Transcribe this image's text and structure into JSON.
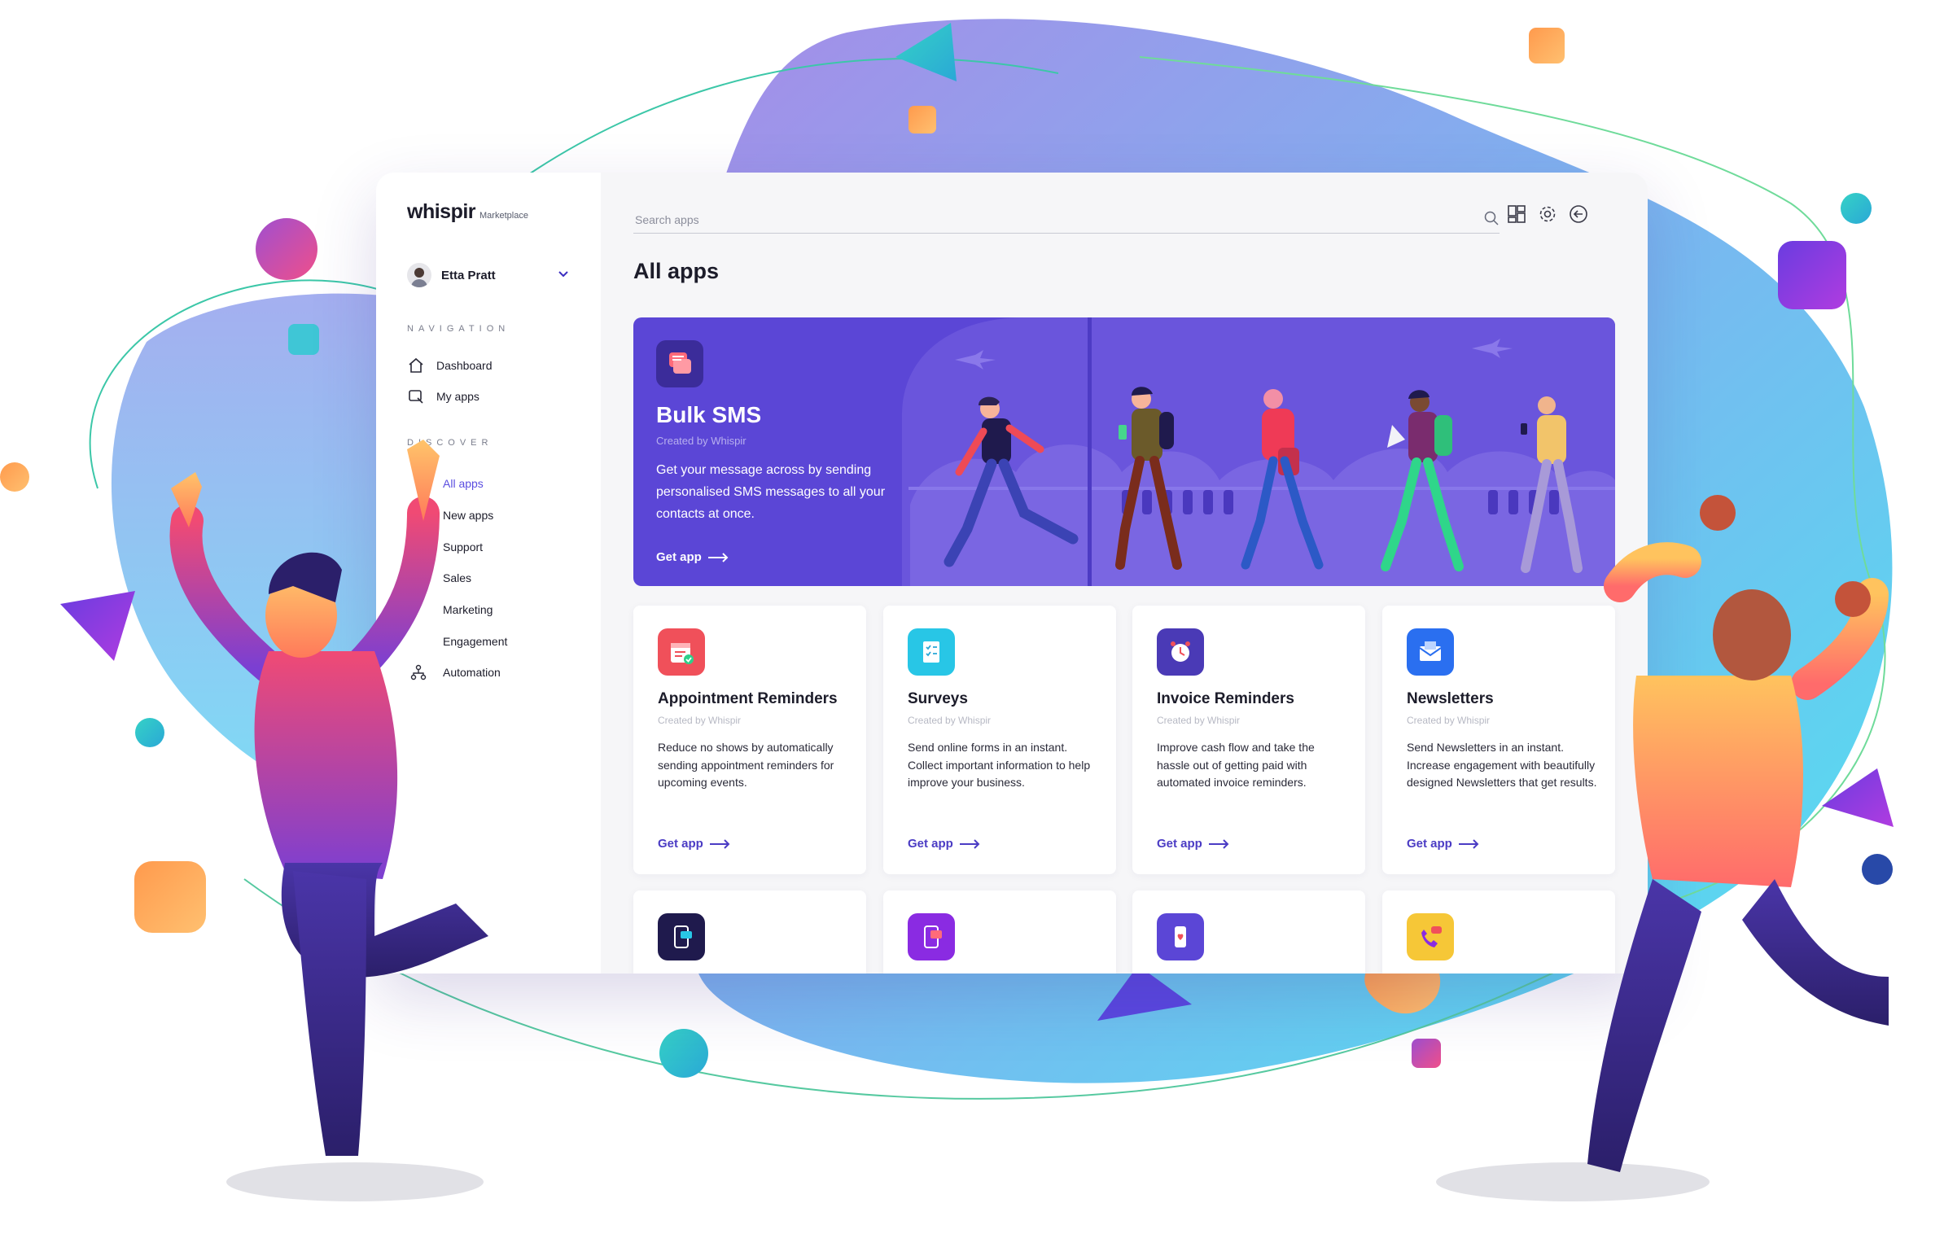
{
  "brand": {
    "logo": "whispir",
    "sub": "Marketplace"
  },
  "user": {
    "name": "Etta Pratt"
  },
  "sidebar": {
    "navigation_heading": "NAVIGATION",
    "nav_items": [
      {
        "label": "Dashboard",
        "icon": "home-icon"
      },
      {
        "label": "My apps",
        "icon": "my-apps-icon"
      }
    ],
    "discover_heading": "DISCOVER",
    "discover_items": [
      {
        "label": "All apps",
        "active": true
      },
      {
        "label": "New apps"
      },
      {
        "label": "Support"
      },
      {
        "label": "Sales"
      },
      {
        "label": "Marketing"
      },
      {
        "label": "Engagement"
      },
      {
        "label": "Automation"
      }
    ]
  },
  "search": {
    "placeholder": "Search apps"
  },
  "page": {
    "title": "All apps"
  },
  "featured": {
    "title": "Bulk SMS",
    "created": "Created by Whispir",
    "description": "Get your message across by sending personalised SMS messages to all your contacts at once.",
    "cta": "Get app"
  },
  "apps": [
    {
      "title": "Appointment Reminders",
      "created": "Created by Whispir",
      "description": "Reduce no shows by automatically sending appointment reminders for upcoming events.",
      "cta": "Get app",
      "icon": "calendar-check-icon",
      "color": "#f0505a"
    },
    {
      "title": "Surveys",
      "created": "Created by Whispir",
      "description": "Send online forms in an instant. Collect important information to help improve your business.",
      "cta": "Get app",
      "icon": "survey-form-icon",
      "color": "#28c6e6"
    },
    {
      "title": "Invoice Reminders",
      "created": "Created by Whispir",
      "description": "Improve cash flow and take the hassle out of getting paid with automated invoice reminders.",
      "cta": "Get app",
      "icon": "alarm-clock-icon",
      "color": "#4a3ab6"
    },
    {
      "title": "Newsletters",
      "created": "Created by Whispir",
      "description": "Send Newsletters in an instant. Increase engagement with beautifully designed Newsletters that get results.",
      "cta": "Get app",
      "icon": "envelope-icon",
      "color": "#2a6ff0"
    }
  ],
  "more_apps": [
    {
      "icon": "mobile-message-icon",
      "color": "#1f1a4d"
    },
    {
      "icon": "mobile-mail-icon",
      "color": "#8a2be2"
    },
    {
      "icon": "mobile-heart-icon",
      "color": "#5b46d6"
    },
    {
      "icon": "phone-chat-icon",
      "color": "#f6c737"
    }
  ]
}
